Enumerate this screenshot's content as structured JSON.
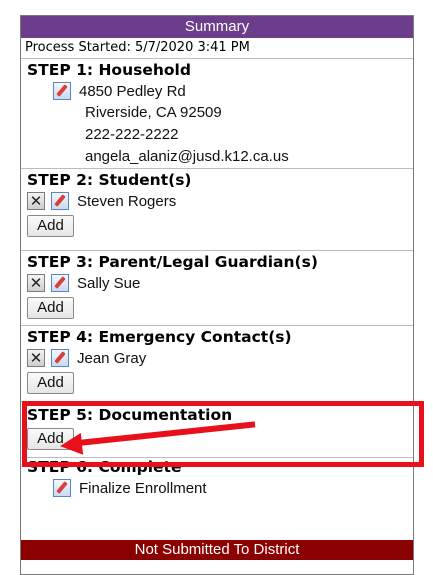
{
  "summary": {
    "title": "Summary",
    "process_started": "Process Started: 5/7/2020 3:41 PM"
  },
  "steps": [
    {
      "title": "STEP 1: Household",
      "lines": [
        "4850 Pedley Rd",
        "Riverside, CA 92509",
        "222-222-2222",
        "angela_alaniz@jusd.k12.ca.us"
      ]
    },
    {
      "title": "STEP 2: Student(s)",
      "entry": "Steven Rogers",
      "add_label": "Add"
    },
    {
      "title": "STEP 3: Parent/Legal Guardian(s)",
      "entry": "Sally Sue",
      "add_label": "Add"
    },
    {
      "title": "STEP 4: Emergency Contact(s)",
      "entry": "Jean Gray",
      "add_label": "Add"
    },
    {
      "title": "STEP 5: Documentation",
      "add_label": "Add"
    },
    {
      "title": "STEP 6: Complete",
      "entry": "Finalize Enrollment"
    }
  ],
  "status": {
    "text": "Not Submitted To District",
    "color": "#8b0000"
  },
  "icons": {
    "edit": "edit-icon",
    "delete": "delete-icon"
  },
  "annotation": {
    "color": "#e8101a"
  }
}
